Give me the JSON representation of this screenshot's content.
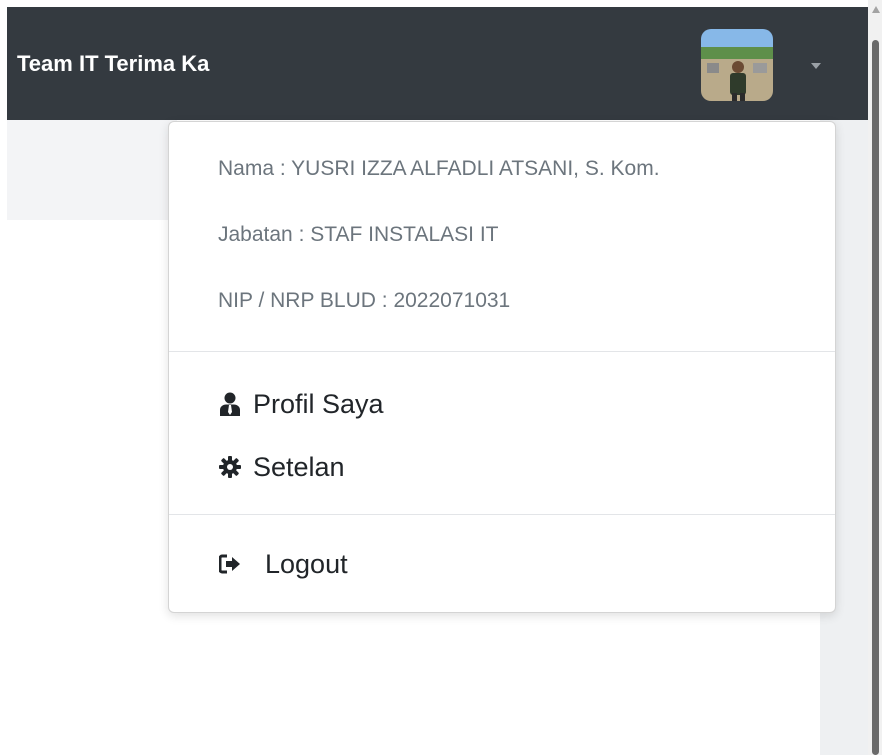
{
  "navbar": {
    "brand_text": "Team IT Terima Ka"
  },
  "user": {
    "nama": "Nama : YUSRI IZZA ALFADLI ATSANI, S. Kom.",
    "jabatan": "Jabatan : STAF INSTALASI IT",
    "nip": "NIP / NRP BLUD : 2022071031"
  },
  "menu": {
    "profile_label": "Profil Saya",
    "profile_icon": "user-tie-icon",
    "settings_label": "Setelan",
    "settings_icon": "gear-icon",
    "logout_label": "Logout",
    "logout_icon": "sign-out-icon"
  },
  "colors": {
    "navbar_bg": "#343a40",
    "muted_text": "#6c757d",
    "menu_text": "#212529"
  }
}
